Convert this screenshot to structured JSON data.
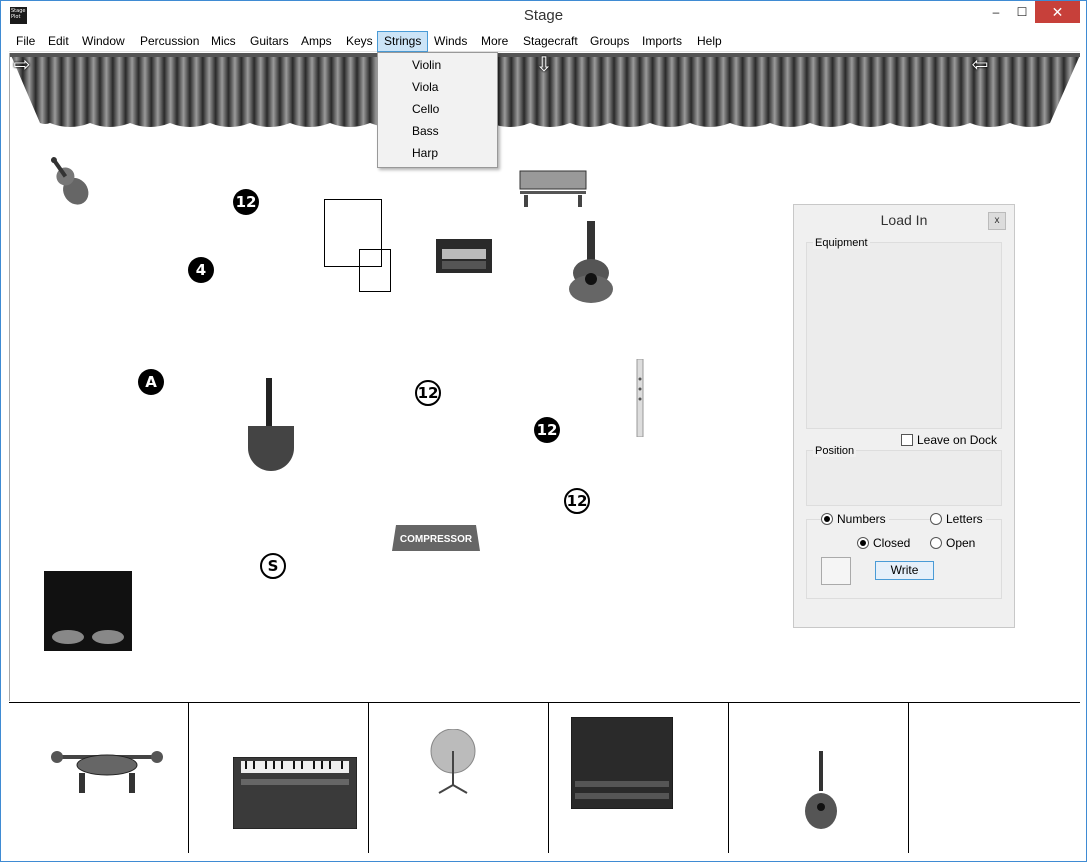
{
  "window": {
    "title": "Stage",
    "app_icon_text": "Stage Plot"
  },
  "window_controls": {
    "minimize": "–",
    "maximize": "☐",
    "close": "✕"
  },
  "menubar": {
    "items": [
      "File",
      "Edit",
      "Window",
      "Percussion",
      "Mics",
      "Guitars",
      "Amps",
      "Keys",
      "Strings",
      "Winds",
      "More",
      "Stagecraft",
      "Groups",
      "Imports",
      "Help"
    ],
    "active": "Strings"
  },
  "strings_menu": {
    "items": [
      "Violin",
      "Viola",
      "Cello",
      "Bass",
      "Harp"
    ]
  },
  "stage": {
    "arrows": {
      "left": "⇨",
      "center": "⇩",
      "right": "⇦"
    },
    "badges": [
      "12",
      "4",
      "A",
      "12",
      "12",
      "12",
      "S"
    ],
    "compressor_label": "COMPRESSOR"
  },
  "load_in_panel": {
    "title": "Load In",
    "close": "x",
    "equipment_label": "Equipment",
    "leave_on_dock_label": "Leave on Dock",
    "leave_on_dock_checked": false,
    "position_label": "Position",
    "numbers_label": "Numbers",
    "letters_label": "Letters",
    "closed_label": "Closed",
    "open_label": "Open",
    "numbers_selected": true,
    "closed_selected": true,
    "write_label": "Write"
  },
  "dock": {
    "items": [
      "drum-throne-icon",
      "keyboard-amp-icon",
      "cymbal-icon",
      "speaker-cabinet-icon",
      "mandolin-icon",
      "empty"
    ]
  },
  "colors": {
    "accent": "#4a9bd6",
    "close_button": "#c7403a",
    "menu_highlight": "#cce4f7"
  }
}
